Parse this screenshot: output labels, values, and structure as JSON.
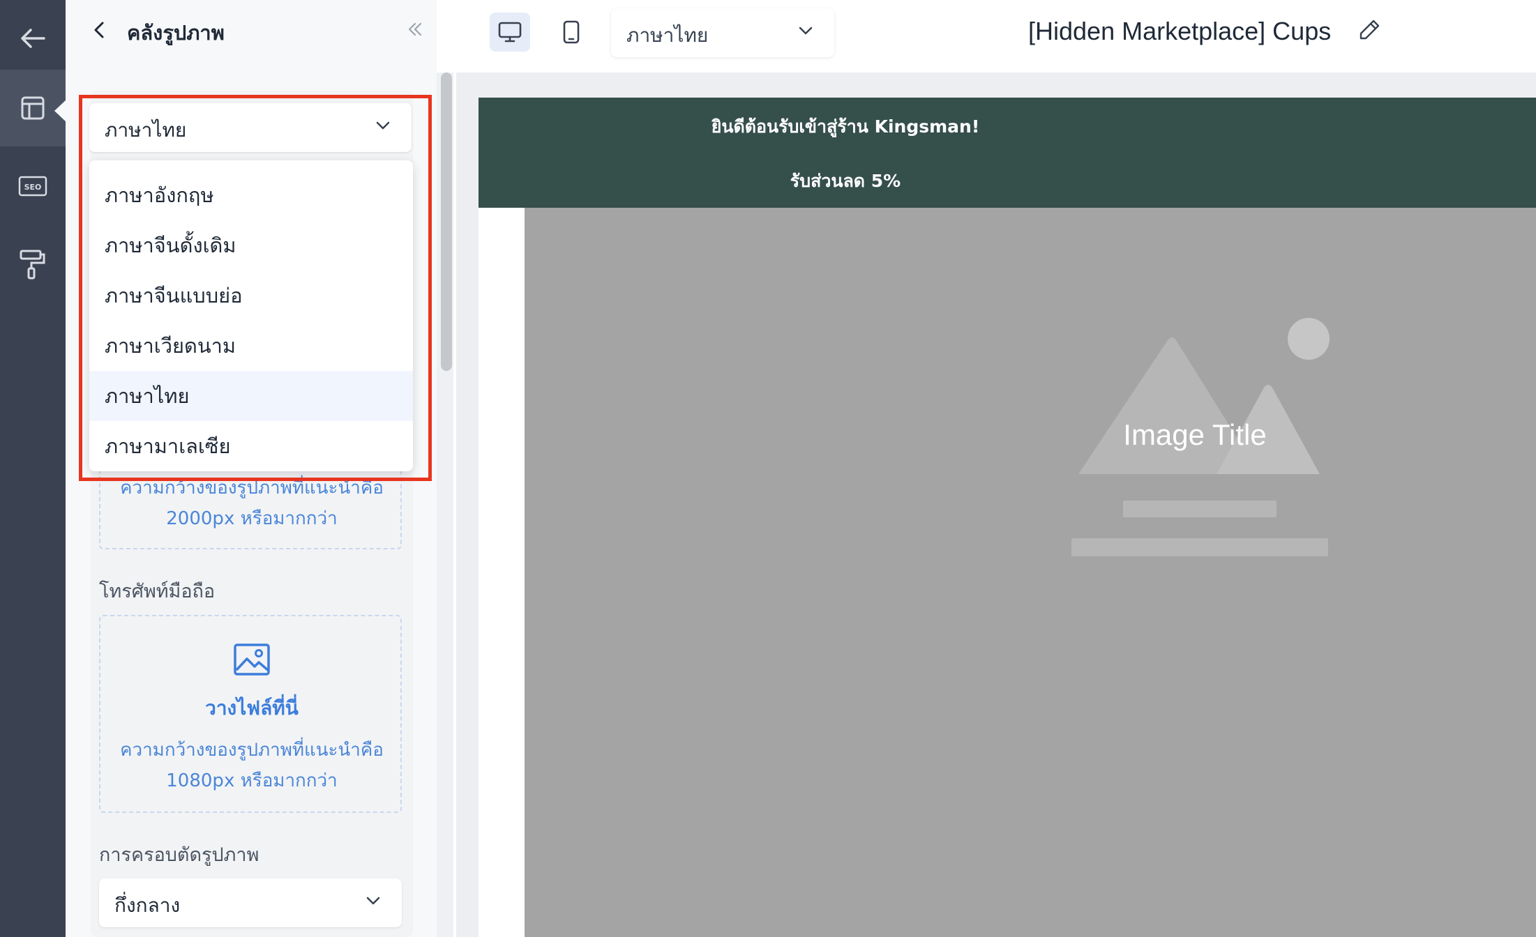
{
  "panel": {
    "title": "คลังรูปภาพ",
    "language_select": {
      "value": "ภาษาไทย"
    },
    "language_options": [
      {
        "label": "ภาษาอังกฤษ",
        "selected": false
      },
      {
        "label": "ภาษาจีนดั้งเดิม",
        "selected": false
      },
      {
        "label": "ภาษาจีนแบบย่อ",
        "selected": false
      },
      {
        "label": "ภาษาเวียดนาม",
        "selected": false
      },
      {
        "label": "ภาษาไทย",
        "selected": true
      },
      {
        "label": "ภาษามาเลเซีย",
        "selected": false
      }
    ],
    "desktop_upload": {
      "hint_line1": "ความกว้างของรูปภาพที่แนะนำคือ",
      "hint_line2": "2000px หรือมากกว่า"
    },
    "mobile_label": "โทรศัพท์มือถือ",
    "mobile_upload": {
      "cta": "วางไฟล์ที่นี่",
      "hint_line1": "ความกว้างของรูปภาพที่แนะนำคือ",
      "hint_line2": "1080px หรือมากกว่า"
    },
    "crop_label": "การครอบตัดรูปภาพ",
    "crop_select": {
      "value": "กึ่งกลาง"
    }
  },
  "topbar": {
    "language_select": {
      "value": "ภาษาไทย"
    },
    "page_title": "[Hidden Marketplace] Cups"
  },
  "preview": {
    "banner_line1": "ยินดีต้อนรับเข้าสู่ร้าน Kingsman!",
    "banner_line2": "รับส่วนลด 5%",
    "hero_title": "Image Title"
  },
  "icons": {
    "rail": [
      "back-arrow-icon",
      "layout-icon",
      "seo-icon",
      "paint-roller-icon"
    ],
    "topbar": [
      "desktop-icon",
      "mobile-icon",
      "chevron-down-icon",
      "pencil-icon"
    ]
  },
  "colors": {
    "rail_bg": "#3a4150",
    "banner_bg": "#354f4b",
    "accent_blue": "#3c7ddc",
    "highlight_red": "#e8351f",
    "hero_bg": "#a4a4a4"
  }
}
